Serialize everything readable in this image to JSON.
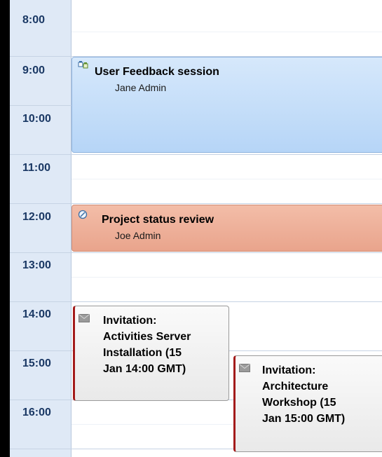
{
  "time_labels": [
    "8:00",
    "9:00",
    "10:00",
    "11:00",
    "12:00",
    "13:00",
    "14:00",
    "15:00",
    "16:00"
  ],
  "events": [
    {
      "title": "User Feedback session",
      "subtitle": "Jane Admin",
      "icon": "meeting-icon",
      "color": "#c3ddf9"
    },
    {
      "title": "Project status review",
      "subtitle": "Joe Admin",
      "icon": "task-icon",
      "color": "#eeae96"
    },
    {
      "title_lines": [
        "Invitation:",
        "Activities Server",
        "Installation (15",
        "Jan 14:00 GMT)"
      ],
      "icon": "envelope-icon",
      "color": "#f2f2f2"
    },
    {
      "title_lines": [
        "Invitation:",
        "Architecture",
        "Workshop (15",
        "Jan 15:00 GMT)"
      ],
      "icon": "envelope-icon",
      "color": "#f2f2f2"
    }
  ]
}
